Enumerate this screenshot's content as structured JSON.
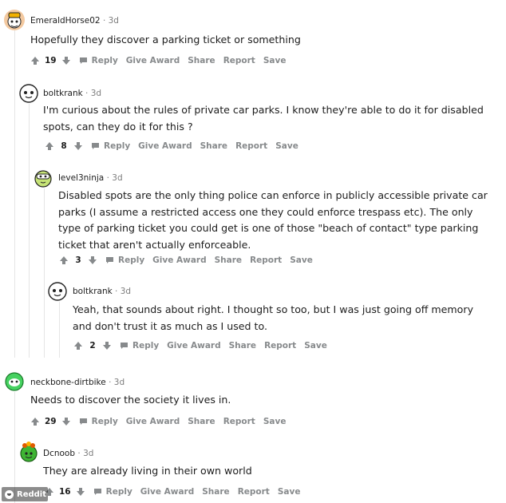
{
  "comments": [
    {
      "user": "EmeraldHorse02",
      "dot": "·",
      "time": "3d",
      "text": "Hopefully they discover a parking ticket or something",
      "score": "19",
      "actions": {
        "reply": "Reply",
        "give_award": "Give Award",
        "share": "Share",
        "report": "Report",
        "save": "Save"
      },
      "avatar_color": "#f2b100"
    },
    {
      "user": "boltkrank",
      "dot": "·",
      "time": "3d",
      "text": "I'm curious about the rules of private car parks. I know they're able to do it for disabled spots, can they do it for this ?",
      "score": "8",
      "actions": {
        "reply": "Reply",
        "give_award": "Give Award",
        "share": "Share",
        "report": "Report",
        "save": "Save"
      },
      "avatar_color": "#d7dadc"
    },
    {
      "user": "level3ninja",
      "dot": "·",
      "time": "3d",
      "text": "Disabled spots are the only thing police can enforce in publicly accessible private car parks (I assume a restricted access one they could enforce trespass etc). The only type of parking ticket you could get is one of those \"beach of contact\" type parking ticket that aren't actually enforceable.",
      "score": "3",
      "actions": {
        "reply": "Reply",
        "give_award": "Give Award",
        "share": "Share",
        "report": "Report",
        "save": "Save"
      },
      "avatar_color": "#c6e377"
    },
    {
      "user": "boltkrank",
      "dot": "·",
      "time": "3d",
      "text": "Yeah, that sounds about right. I thought so too, but I was just going off memory and don't trust it as much as I used to.",
      "score": "2",
      "actions": {
        "reply": "Reply",
        "give_award": "Give Award",
        "share": "Share",
        "report": "Report",
        "save": "Save"
      },
      "avatar_color": "#d7dadc"
    },
    {
      "user": "neckbone-dirtbike",
      "dot": "·",
      "time": "3d",
      "text": "Needs to discover the society it lives in.",
      "score": "29",
      "actions": {
        "reply": "Reply",
        "give_award": "Give Award",
        "share": "Share",
        "report": "Report",
        "save": "Save"
      },
      "avatar_color": "#46d160"
    },
    {
      "user": "Dcnoob",
      "dot": "·",
      "time": "3d",
      "text": "They are already living in their own world",
      "score": "16",
      "actions": {
        "reply": "Reply",
        "give_award": "Give Award",
        "share": "Share",
        "report": "Report",
        "save": "Save"
      },
      "avatar_color": "#3fb534"
    }
  ],
  "watermark": {
    "label": "Reddit"
  },
  "colors": {
    "meta": "#878a8c",
    "text": "#1c1c1c",
    "thread_line": "#e5e5e5"
  }
}
